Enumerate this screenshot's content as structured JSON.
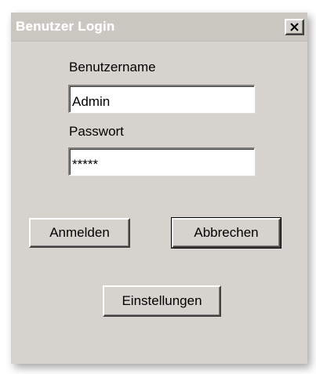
{
  "window": {
    "title": "Benutzer Login",
    "close_symbol": "X"
  },
  "form": {
    "username_label": "Benutzername",
    "username_value": "Admin",
    "password_label": "Passwort",
    "password_value": "*****"
  },
  "buttons": {
    "login_label": "Anmelden",
    "cancel_label": "Abbrechen",
    "settings_label": "Einstellungen"
  },
  "icons": {
    "close": "close-icon"
  },
  "colors": {
    "dialog_background": "#d6d3ce",
    "titlebar_background": "#cac7c1",
    "title_text": "#ffffff"
  }
}
